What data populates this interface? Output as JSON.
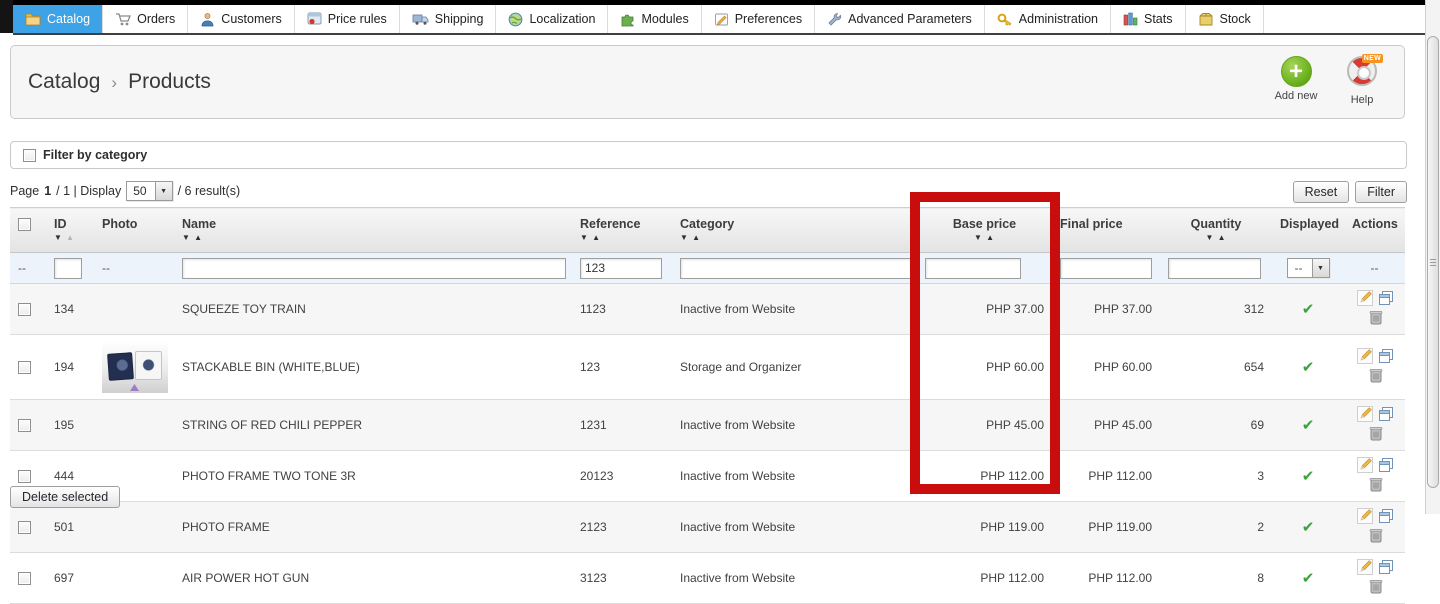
{
  "nav": {
    "tabs": [
      {
        "label": "Catalog",
        "icon": "folder-icon",
        "active": true
      },
      {
        "label": "Orders",
        "icon": "cart-icon",
        "active": false
      },
      {
        "label": "Customers",
        "icon": "customers-icon",
        "active": false
      },
      {
        "label": "Price rules",
        "icon": "price-rules-icon",
        "active": false
      },
      {
        "label": "Shipping",
        "icon": "shipping-icon",
        "active": false
      },
      {
        "label": "Localization",
        "icon": "localization-icon",
        "active": false
      },
      {
        "label": "Modules",
        "icon": "modules-icon",
        "active": false
      },
      {
        "label": "Preferences",
        "icon": "preferences-icon",
        "active": false
      },
      {
        "label": "Advanced Parameters",
        "icon": "advanced-parameters-icon",
        "active": false
      },
      {
        "label": "Administration",
        "icon": "administration-icon",
        "active": false
      },
      {
        "label": "Stats",
        "icon": "stats-icon",
        "active": false
      },
      {
        "label": "Stock",
        "icon": "stock-icon",
        "active": false
      }
    ]
  },
  "breadcrumb": {
    "section": "Catalog",
    "separator": "›",
    "page": "Products"
  },
  "toolbar": {
    "add_new_label": "Add new",
    "help_label": "Help",
    "help_badge": "NEW"
  },
  "category_filter": {
    "label": "Filter by category"
  },
  "pagination": {
    "page_label": "Page",
    "current_page": "1",
    "total_suffix": "/ 1 | Display",
    "page_size": "50",
    "results_suffix": "/ 6 result(s)"
  },
  "buttons": {
    "reset": "Reset",
    "filter": "Filter",
    "delete_selected": "Delete selected"
  },
  "icons": {
    "sort_down": "▼",
    "sort_up": "▲",
    "select_arrow": "▼",
    "check": "✔",
    "plus": "+"
  },
  "annotation": {
    "highlight_color": "#c90d0d",
    "highlighted_column": "Base price"
  },
  "table": {
    "columns": {
      "id": "ID",
      "photo": "Photo",
      "name": "Name",
      "reference": "Reference",
      "category": "Category",
      "base_price": "Base price",
      "final_price": "Final price",
      "quantity": "Quantity",
      "displayed": "Displayed",
      "actions": "Actions"
    },
    "filter_row": {
      "leading": "--",
      "photo_placeholder": "--",
      "id_value": "",
      "name_value": "",
      "reference_value": "123",
      "category_value": "",
      "base_price_value": "",
      "final_price_value": "",
      "quantity_value": "",
      "displayed_value": "--",
      "actions_placeholder": "--"
    },
    "rows": [
      {
        "id": "134",
        "name": "SQUEEZE TOY TRAIN",
        "reference": "1123",
        "category": "Inactive from Website",
        "base_price": "PHP 37.00",
        "final_price": "PHP 37.00",
        "quantity": "312",
        "displayed": true,
        "has_photo": false
      },
      {
        "id": "194",
        "name": "STACKABLE BIN (WHITE,BLUE)",
        "reference": "123",
        "category": "Storage and Organizer",
        "base_price": "PHP 60.00",
        "final_price": "PHP 60.00",
        "quantity": "654",
        "displayed": true,
        "has_photo": true
      },
      {
        "id": "195",
        "name": "STRING OF RED CHILI PEPPER",
        "reference": "1231",
        "category": "Inactive from Website",
        "base_price": "PHP 45.00",
        "final_price": "PHP 45.00",
        "quantity": "69",
        "displayed": true,
        "has_photo": false
      },
      {
        "id": "444",
        "name": "PHOTO FRAME TWO TONE 3R",
        "reference": "20123",
        "category": "Inactive from Website",
        "base_price": "PHP 112.00",
        "final_price": "PHP 112.00",
        "quantity": "3",
        "displayed": true,
        "has_photo": false
      },
      {
        "id": "501",
        "name": "PHOTO FRAME",
        "reference": "2123",
        "category": "Inactive from Website",
        "base_price": "PHP 119.00",
        "final_price": "PHP 119.00",
        "quantity": "2",
        "displayed": true,
        "has_photo": false
      },
      {
        "id": "697",
        "name": "AIR POWER HOT GUN",
        "reference": "3123",
        "category": "Inactive from Website",
        "base_price": "PHP 112.00",
        "final_price": "PHP 112.00",
        "quantity": "8",
        "displayed": true,
        "has_photo": false
      }
    ]
  }
}
